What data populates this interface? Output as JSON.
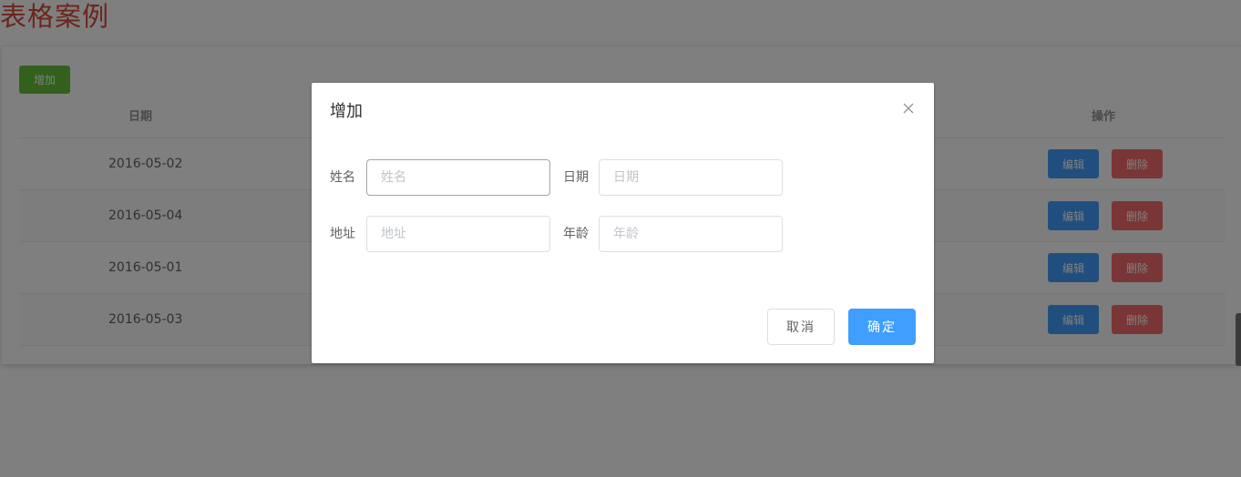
{
  "page": {
    "title": "表格案例"
  },
  "toolbar": {
    "add_label": "增加"
  },
  "table": {
    "headers": {
      "date": "日期",
      "actions": "操作"
    },
    "rows": [
      {
        "date": "2016-05-02",
        "edit_label": "编辑",
        "delete_label": "删除"
      },
      {
        "date": "2016-05-04",
        "edit_label": "编辑",
        "delete_label": "删除"
      },
      {
        "date": "2016-05-01",
        "edit_label": "编辑",
        "delete_label": "删除"
      },
      {
        "date": "2016-05-03",
        "edit_label": "编辑",
        "delete_label": "删除"
      }
    ]
  },
  "dialog": {
    "title": "增加",
    "close_icon": "close-icon",
    "fields": {
      "name": {
        "label": "姓名",
        "value": "",
        "placeholder": "姓名"
      },
      "date": {
        "label": "日期",
        "value": "",
        "placeholder": "日期"
      },
      "address": {
        "label": "地址",
        "value": "",
        "placeholder": "地址"
      },
      "age": {
        "label": "年龄",
        "value": "",
        "placeholder": "年龄"
      }
    },
    "cancel_label": "取消",
    "confirm_label": "确定"
  },
  "colors": {
    "title": "#d44b3a",
    "success": "#67c23a",
    "primary": "#409eff",
    "danger": "#f56c6c",
    "overlay": "rgba(0,0,0,0.5)"
  }
}
